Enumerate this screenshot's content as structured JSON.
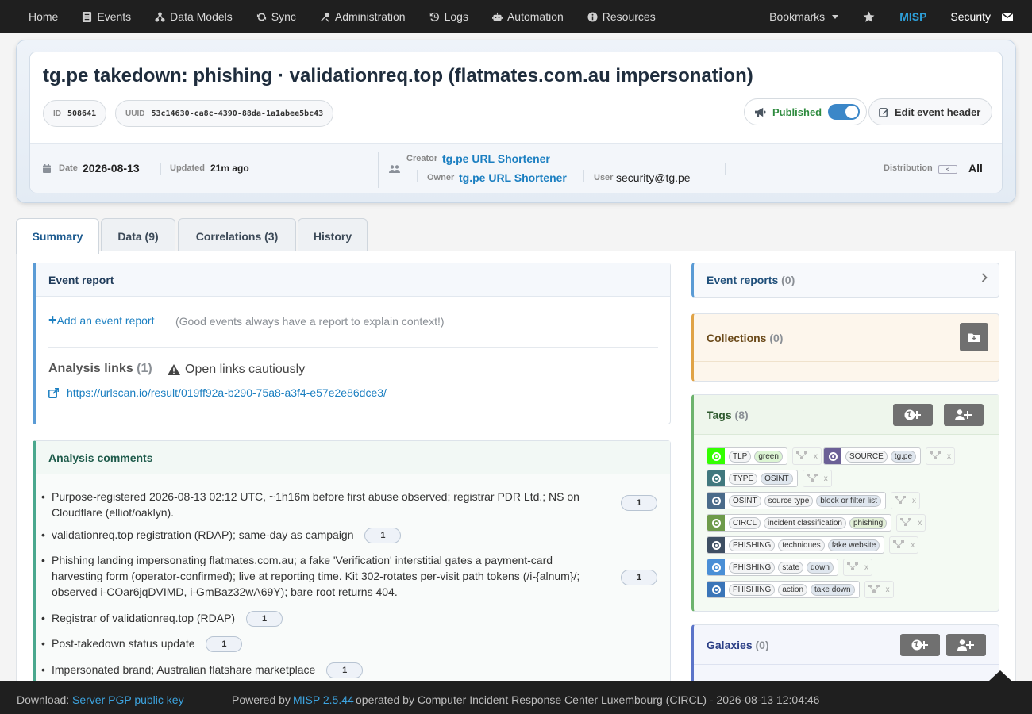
{
  "nav": {
    "items": [
      {
        "label": "Home",
        "icon": ""
      },
      {
        "label": "Events",
        "icon": "list-icon"
      },
      {
        "label": "Data Models",
        "icon": "shapes-icon"
      },
      {
        "label": "Sync",
        "icon": "sync-icon"
      },
      {
        "label": "Administration",
        "icon": "tools-icon"
      },
      {
        "label": "Logs",
        "icon": "history-icon"
      },
      {
        "label": "Automation",
        "icon": "robot-icon"
      },
      {
        "label": "Resources",
        "icon": "info-icon"
      }
    ],
    "bookmarks": "Bookmarks",
    "misp": "MISP",
    "user": "Security"
  },
  "event": {
    "title": "tg.pe takedown: phishing · validationreq.top (flatmates.com.au impersonation)",
    "id_label": "ID",
    "id": "508641",
    "uuid_label": "UUID",
    "uuid": "53c14630-ca8c-4390-88da-1a1abee5bc43",
    "published_label": "Published",
    "published": true,
    "edit_label": "Edit event header",
    "date_label": "Date",
    "date": "2026-08-13",
    "updated_label": "Updated",
    "updated": "21m ago",
    "creator_label": "Creator",
    "creator": "tg.pe URL Shortener",
    "owner_label": "Owner",
    "owner": "tg.pe URL Shortener",
    "user_label": "User",
    "user": "security@tg.pe",
    "distribution_label": "Distribution",
    "distribution": "All"
  },
  "tabs": [
    {
      "label": "Summary",
      "active": true
    },
    {
      "label": "Data (9)",
      "active": false
    },
    {
      "label": "Correlations (3)",
      "active": false
    },
    {
      "label": "History",
      "active": false
    }
  ],
  "event_report": {
    "title": "Event report",
    "add_label": "Add an event report",
    "hint": "(Good events always have a report to explain context!)",
    "analysis_links_title": "Analysis links",
    "analysis_links_count": "(1)",
    "caution": "Open links cautiously",
    "link": "https://urlscan.io/result/019ff92a-b290-75a8-a3f4-e57e2e86dce3/"
  },
  "analysis_comments": {
    "title": "Analysis comments",
    "items": [
      {
        "text": "Purpose-registered 2026-08-13 02:12 UTC, ~1h16m before first abuse observed; registrar PDR Ltd.; NS on Cloudflare (elliot/oaklyn).",
        "count": "1"
      },
      {
        "text": "validationreq.top registration (RDAP); same-day as campaign",
        "count": "1"
      },
      {
        "text": "Phishing landing impersonating flatmates.com.au; a fake 'Verification' interstitial gates a payment-card harvesting form (operator-confirmed); live at reporting time. Kit 302-rotates per-visit path tokens (/i-{alnum}/; observed i-COar6jqDVIMD, i-GmBaz32wA69Y); bare root returns 404.",
        "count": "1"
      },
      {
        "text": "Registrar of validationreq.top (RDAP)",
        "count": "1"
      },
      {
        "text": "Post-takedown status update",
        "count": "1"
      },
      {
        "text": "Impersonated brand; Australian flatshare marketplace",
        "count": "1"
      }
    ]
  },
  "side": {
    "event_reports_title": "Event reports",
    "event_reports_count": "(0)",
    "collections_title": "Collections",
    "collections_count": "(0)",
    "tags_title": "Tags",
    "tags_count": "(8)",
    "galaxies_title": "Galaxies",
    "galaxies_count": "(0)"
  },
  "tags": [
    {
      "color": "#33ff00",
      "segs": [
        "TLP",
        "green"
      ]
    },
    {
      "color": "#6b6096",
      "segs": [
        "SOURCE",
        "tg.pe"
      ]
    },
    {
      "color": "#41787e",
      "segs": [
        "TYPE",
        "OSINT"
      ]
    },
    {
      "color": "#4a6b8a",
      "segs": [
        "OSINT",
        "source type",
        "block or filter list"
      ]
    },
    {
      "color": "#6e9b4a",
      "segs": [
        "CIRCL",
        "incident classification",
        "phishing"
      ]
    },
    {
      "color": "#3e4f63",
      "segs": [
        "PHISHING",
        "techniques",
        "fake website"
      ]
    },
    {
      "color": "#4a8fd6",
      "segs": [
        "PHISHING",
        "state",
        "down"
      ]
    },
    {
      "color": "#3a75b8",
      "segs": [
        "PHISHING",
        "action",
        "take down"
      ]
    }
  ],
  "footer": {
    "download_label": "Download:",
    "pgp_link": "Server PGP public key",
    "powered_by": "Powered by",
    "misp_version": "MISP 2.5.44",
    "operated_by": "operated by Computer Incident Response Center Luxembourg (CIRCL) - 2026-08-13 12:04:46"
  }
}
